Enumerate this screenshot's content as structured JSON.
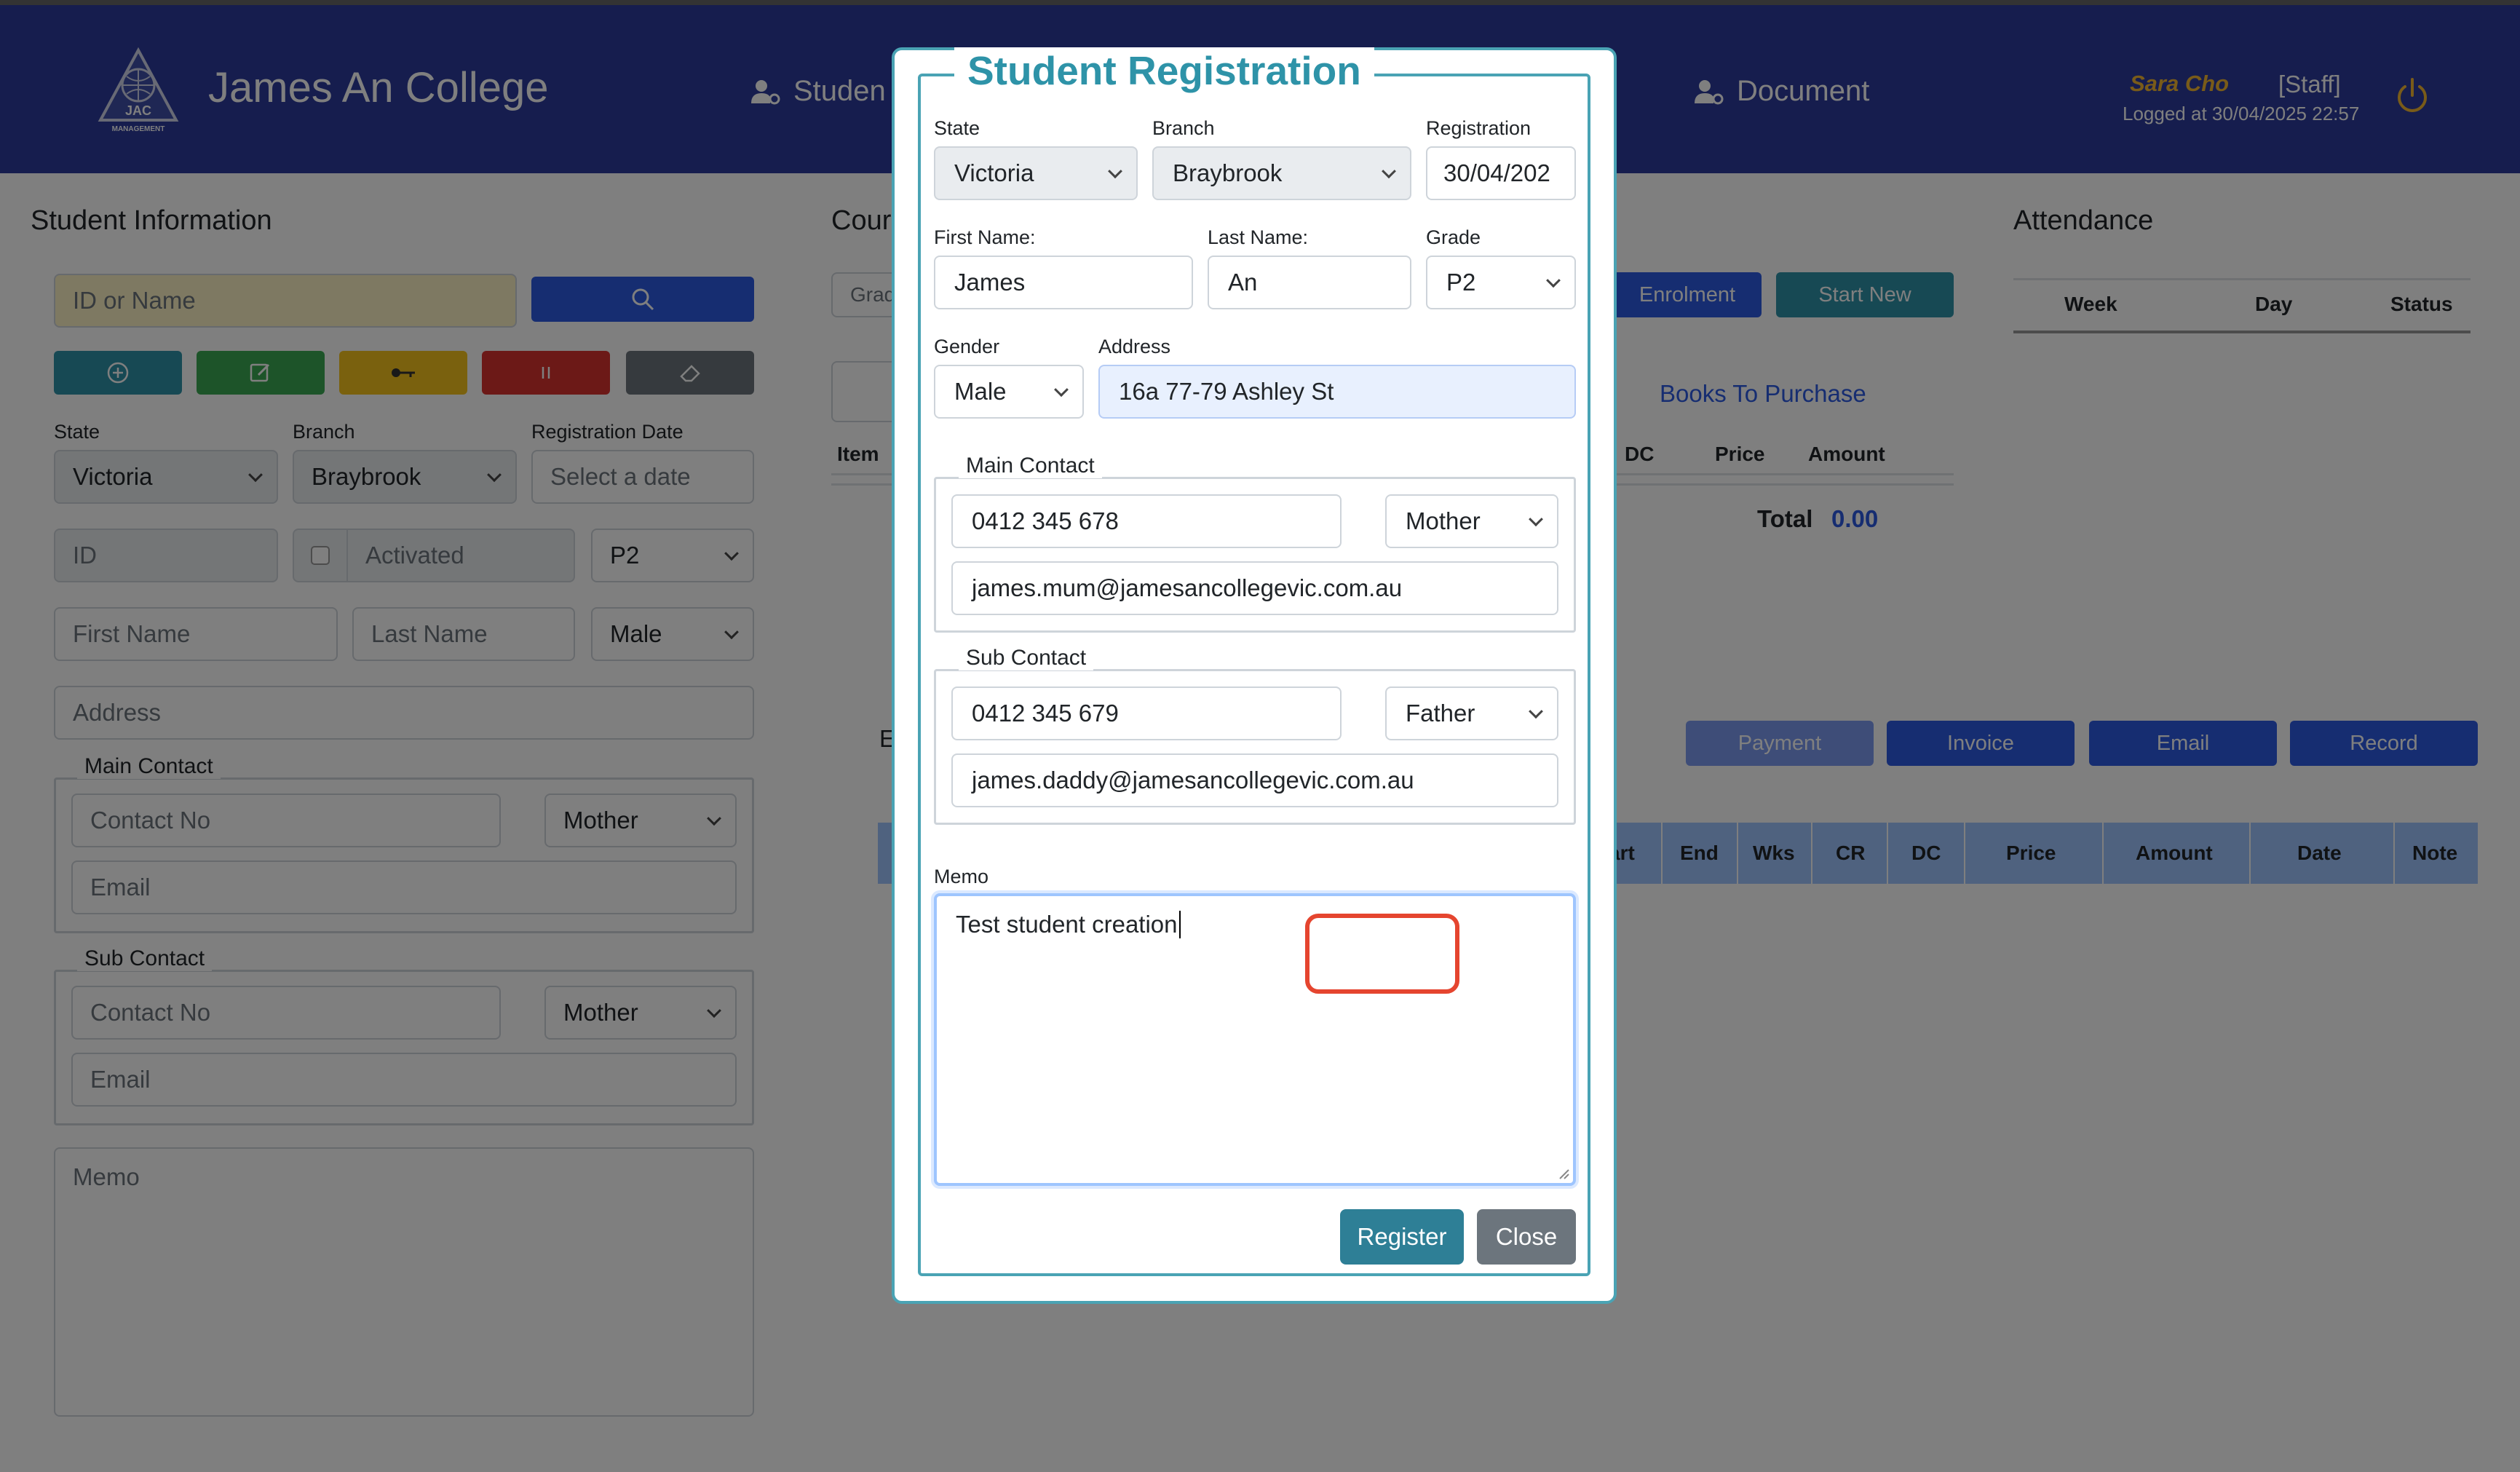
{
  "header": {
    "app_title": "James An College",
    "logo_text": "JAC",
    "logo_subtext": "MANAGEMENT",
    "nav_student": "Studen",
    "nav_document": "Document",
    "user_name": "Sara Cho",
    "user_role": "[Staff]",
    "logged_at": "Logged at 30/04/2025 22:57"
  },
  "student_info": {
    "title": "Student Information",
    "search_placeholder": "ID or Name",
    "state_label": "State",
    "state_value": "Victoria",
    "branch_label": "Branch",
    "branch_value": "Braybrook",
    "reg_date_label": "Registration Date",
    "reg_date_placeholder": "Select a date",
    "id_placeholder": "ID",
    "activated_label": "Activated",
    "grade_value": "P2",
    "first_name_placeholder": "First Name",
    "last_name_placeholder": "Last Name",
    "gender_value": "Male",
    "address_placeholder": "Address",
    "main_contact_legend": "Main Contact",
    "main_contact_no_placeholder": "Contact No",
    "main_relation": "Mother",
    "main_email_placeholder": "Email",
    "sub_contact_legend": "Sub Contact",
    "sub_contact_no_placeholder": "Contact No",
    "sub_relation": "Mother",
    "sub_email_placeholder": "Email",
    "memo_placeholder": "Memo"
  },
  "course": {
    "title": "Cour",
    "grade_stub": "Grad",
    "enrolment_button": "Enrolment",
    "start_new_button": "Start New",
    "books_to_purchase": "Books To Purchase",
    "columns": [
      "Item",
      "DC",
      "Price",
      "Amount"
    ],
    "total_label": "Total",
    "total_value": "0.00",
    "e_stub": "E"
  },
  "attendance": {
    "title": "Attendance",
    "columns": [
      "Week",
      "Day",
      "Status"
    ]
  },
  "actions": {
    "payment": "Payment",
    "invoice": "Invoice",
    "email": "Email",
    "record": "Record"
  },
  "enrol_table": {
    "columns": [
      "art",
      "End",
      "Wks",
      "CR",
      "DC",
      "Price",
      "Amount",
      "Date",
      "Note"
    ]
  },
  "modal": {
    "title": "Student Registration",
    "state_label": "State",
    "state_value": "Victoria",
    "branch_label": "Branch",
    "branch_value": "Braybrook",
    "registration_label": "Registration",
    "registration_value": "30/04/202",
    "first_name_label": "First Name:",
    "first_name_value": "James",
    "last_name_label": "Last Name:",
    "last_name_value": "An",
    "grade_label": "Grade",
    "grade_value": "P2",
    "gender_label": "Gender",
    "gender_value": "Male",
    "address_label": "Address",
    "address_value": "16a 77-79 Ashley St",
    "main_contact_legend": "Main Contact",
    "main_phone": "0412 345 678",
    "main_relation": "Mother",
    "main_email": "james.mum@jamesancollegevic.com.au",
    "sub_contact_legend": "Sub Contact",
    "sub_phone": "0412 345 679",
    "sub_relation": "Father",
    "sub_email": "james.daddy@jamesancollegevic.com.au",
    "memo_label": "Memo",
    "memo_value": "Test student creation",
    "register_button": "Register",
    "close_button": "Close"
  },
  "colors": {
    "header_bg": "#2c3a9c",
    "accent_teal": "#2e93a8",
    "primary_blue": "#2d5be3",
    "highlight_red": "#e5452f"
  }
}
